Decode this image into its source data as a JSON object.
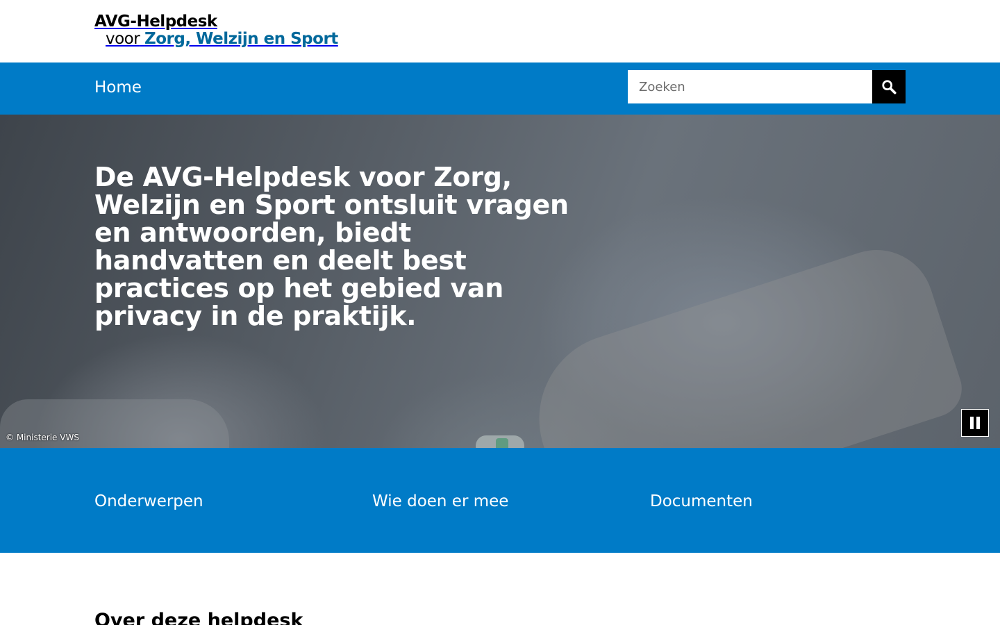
{
  "header": {
    "logo_line1": "AVG-Helpdesk",
    "logo_voor": "voor",
    "logo_sub": "Zorg, Welzijn en Sport"
  },
  "nav": {
    "home_label": "Home",
    "search_placeholder": "Zoeken",
    "search_icon": "search-icon"
  },
  "hero": {
    "title": "De AVG-Helpdesk voor Zorg, Welzijn en Sport ontsluit vragen en antwoorden, biedt handvatten en deelt best practices op het gebied van privacy in de praktijk.",
    "credit": "© Ministerie VWS",
    "pause_icon": "pause-icon"
  },
  "tiles": [
    {
      "label": "Onderwerpen"
    },
    {
      "label": "Wie doen er mee"
    },
    {
      "label": "Documenten"
    }
  ],
  "content": {
    "heading": "Over deze helpdesk"
  },
  "colors": {
    "primary_blue": "#007bc7",
    "logo_blue": "#01689b",
    "search_button": "#000000"
  }
}
